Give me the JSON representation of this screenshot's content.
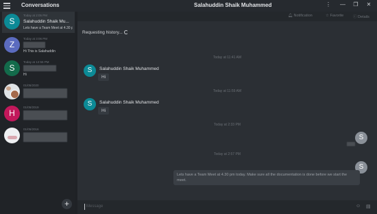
{
  "titlebar": {
    "conversations_label": "Conversations",
    "chat_title": "Salahuddin Shaik Muhammed",
    "kebab": "⋮",
    "minimize": "—",
    "restore": "❐",
    "close": "✕"
  },
  "sidebar": {
    "items": [
      {
        "avatar": "S",
        "color": "#0c8a96",
        "time": "Today at 2:05 PM",
        "name": "Salahuddin Shaik Mu...",
        "message": "Lets have a Team Meet at 4.30 pm t..."
      },
      {
        "avatar": "Z",
        "color": "#5b6bbf",
        "time": "Today at 3:06 PM",
        "message": "Hi This is Salahuddin"
      },
      {
        "avatar": "S",
        "color": "#136b4b",
        "time": "Today at 12:55 PM",
        "message": "Hi"
      },
      {
        "time": "01/05/2020"
      },
      {
        "avatar": "H",
        "color": "#c2185b",
        "time": "01/05/2019"
      },
      {
        "time": "01/05/2016"
      }
    ],
    "add_label": "+"
  },
  "chat": {
    "actions": {
      "notification": "Notification",
      "favorite": "Favorite",
      "details": "Details"
    },
    "requesting": "Requesting history...",
    "dividers": [
      "Today at 11:41 AM",
      "Today at 11:59 AM",
      "Today at 2:33 PM",
      "Today at 2:57 PM"
    ],
    "messages": [
      {
        "avatar": "S",
        "sender": "Salahuddin Shaik Muhammed",
        "text": "Hi"
      },
      {
        "avatar": "S",
        "sender": "Salahuddin Shaik Muhammed",
        "text": "Hi"
      }
    ],
    "outgoing": [
      {
        "avatar": "S"
      },
      {
        "avatar": "S",
        "text": "Lets have a Team Meet at 4.30 pm today. Make sure all the documentation is done before we start the meet."
      }
    ],
    "input_placeholder": "Message"
  }
}
